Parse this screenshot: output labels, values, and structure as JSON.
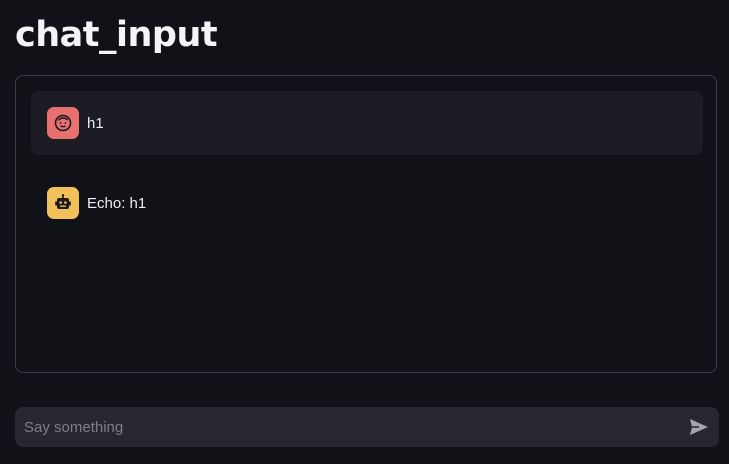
{
  "page": {
    "title": "chat_input"
  },
  "messages": [
    {
      "role": "user",
      "avatar_icon": "user-face-icon",
      "text": "h1"
    },
    {
      "role": "assistant",
      "avatar_icon": "robot-icon",
      "text": "Echo: h1"
    }
  ],
  "input": {
    "placeholder": "Say something",
    "value": "",
    "send_icon": "send-icon"
  },
  "colors": {
    "background": "#111217",
    "user_avatar": "#e8706e",
    "bot_avatar": "#f2c05a",
    "input_background": "#262730",
    "user_message_background": "#1c1d24"
  }
}
